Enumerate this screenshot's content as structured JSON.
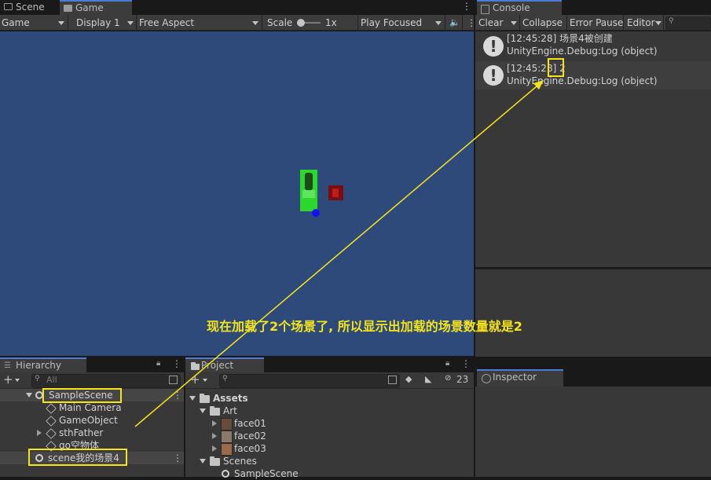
{
  "tabs": {
    "scene": "Scene",
    "game": "Game",
    "console": "Console",
    "hierarchy": "Hierarchy",
    "project": "Project",
    "inspector": "Inspector"
  },
  "game_toolbar": {
    "view": "Game",
    "display": "Display 1",
    "aspect": "Free Aspect",
    "scale_label": "Scale",
    "scale_value": "1x",
    "play_mode": "Play Focused"
  },
  "console_toolbar": {
    "clear": "Clear",
    "collapse": "Collapse",
    "error_pause": "Error Pause",
    "editor": "Editor"
  },
  "console_logs": [
    {
      "time": "[12:45:28]",
      "message": "场景4被创建",
      "source": "UnityEngine.Debug:Log (object)"
    },
    {
      "time": "[12:45:28]",
      "message": "2",
      "source": "UnityEngine.Debug:Log (object)"
    }
  ],
  "hierarchy": {
    "search_placeholder": "All",
    "scenes": [
      {
        "name": "SampleScene",
        "children": [
          "Main Camera",
          "GameObject",
          "sthFather",
          "go空物体"
        ]
      },
      {
        "name": "scene我的场景4",
        "children": []
      }
    ]
  },
  "project": {
    "count": "23",
    "root": "Assets",
    "tree": {
      "art": "Art",
      "art_items": [
        "face01",
        "face02",
        "face03"
      ],
      "scenes": "Scenes",
      "scene_items": [
        "SampleScene"
      ]
    }
  },
  "annotation": {
    "text": "现在加载了2个场景了, 所以显示出加载的场景数量就是2",
    "color": "#f5e41a"
  },
  "colors": {
    "game_bg": "#2e4a7a",
    "accent": "#4c7bd6",
    "highlight": "#f5e41a"
  }
}
